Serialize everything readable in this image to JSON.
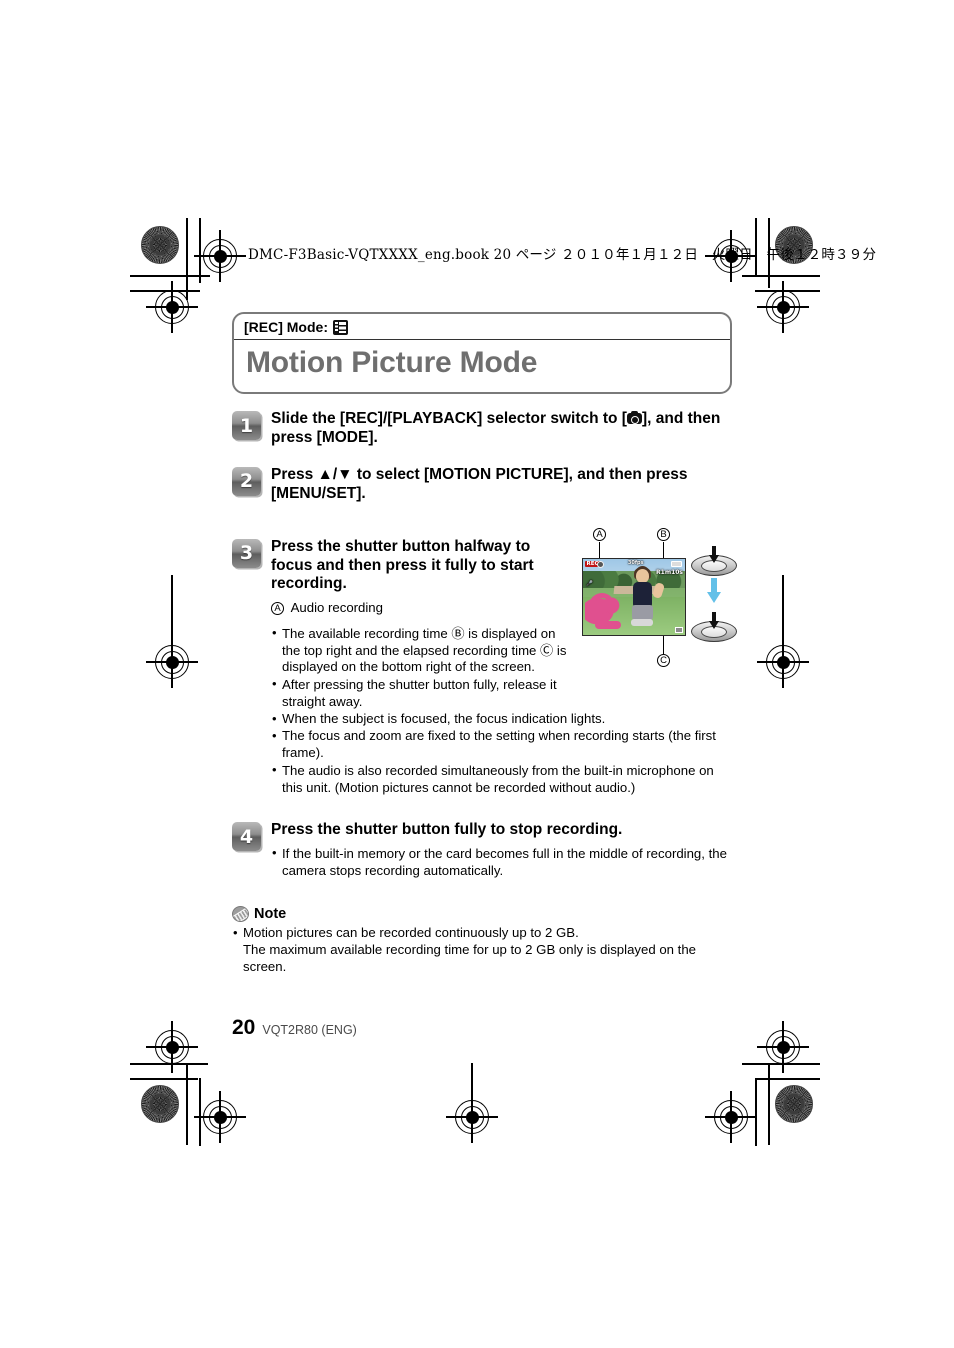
{
  "doc_header": "DMC-F3Basic-VQTXXXX_eng.book  20 ページ  ２０１０年１月１２日　火曜日　午後１２時３９分",
  "title_box": {
    "mode_label": "[REC] Mode:",
    "mode_icon": "motion-picture-icon",
    "heading": "Motion Picture Mode",
    "heading_color": "#6f6f6f",
    "border_color": "#7a7a7a"
  },
  "steps": [
    {
      "number": "1",
      "heading_pre": "Slide the [REC]/[PLAYBACK] selector switch to [",
      "heading_post": "], and then press [MODE].",
      "icon": "camera-icon"
    },
    {
      "number": "2",
      "heading": "Press ▲/▼ to select [MOTION PICTURE], and then press [MENU/SET]."
    },
    {
      "number": "3",
      "heading": "Press the shutter button halfway to focus and then press it fully to start recording.",
      "legend": "Audio recording",
      "legend_marker": "A",
      "bullets": [
        "The available recording time Ⓑ is displayed on the top right and the elapsed recording time Ⓒ is displayed on the bottom right of the screen.",
        "After pressing the shutter button fully, release it straight away.",
        "When the subject is focused, the focus indication lights.",
        "The focus and zoom are fixed to the setting when recording starts (the first frame).",
        "The audio is also recorded simultaneously from the built-in microphone on this unit. (Motion pictures cannot be recorded without audio.)"
      ]
    },
    {
      "number": "4",
      "heading": "Press the shutter button fully to stop recording.",
      "bullets": [
        "If the built-in memory or the card becomes full in the middle of recording, the camera stops recording automatically."
      ]
    }
  ],
  "figure": {
    "callouts": {
      "a": "A",
      "b": "B",
      "c": "C"
    },
    "lcd": {
      "rec_badge": "REC",
      "mode_icon": "gear-icon",
      "audio_label": "🎤",
      "center_indicator": "30fps",
      "battery_icon": "battery-icon",
      "available_time": "R1m10s",
      "elapsed_indicator": "elapsed-time-icon",
      "scene_description": "child-on-flamingo-ride-photo"
    },
    "shutter_top": "shutter-button-halfway",
    "shutter_bottom": "shutter-button-full",
    "transition_arrow": "down-arrow",
    "transition_arrow_color": "#63c0e8"
  },
  "note": {
    "title": "Note",
    "icon": "note-pencil-icon",
    "bullets": [
      "Motion pictures can be recorded continuously up to 2 GB.",
      "The maximum available recording time for up to 2 GB only is displayed on the screen."
    ]
  },
  "footer": {
    "page_number": "20",
    "code": "VQT2R80 (ENG)"
  }
}
